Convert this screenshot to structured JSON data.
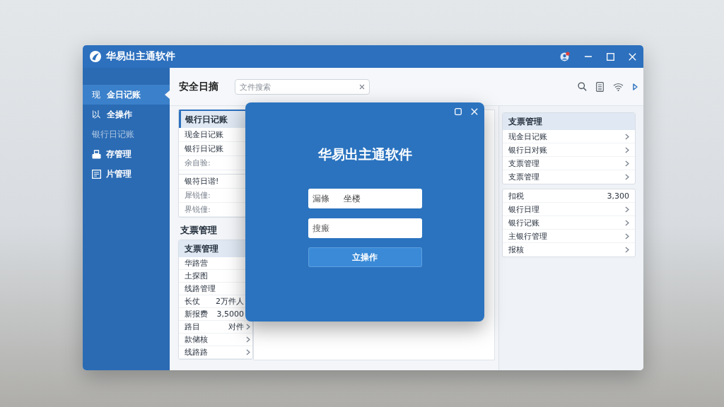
{
  "window": {
    "title": "华易出主通软件"
  },
  "sidebar": {
    "items": [
      {
        "kind": "glyph",
        "glyph": "现",
        "label": "金日记账",
        "selected": true,
        "disabled": false
      },
      {
        "kind": "glyph",
        "glyph": "以",
        "label": "全操作",
        "selected": false,
        "disabled": false
      },
      {
        "kind": "plain",
        "label": "银行日记账",
        "selected": false,
        "disabled": true
      },
      {
        "kind": "tray",
        "label": "存管理",
        "selected": false,
        "disabled": false
      },
      {
        "kind": "form",
        "label": "片管理",
        "selected": false,
        "disabled": false
      }
    ]
  },
  "header": {
    "title": "安全日摘",
    "search": {
      "placeholder": "文件搜索"
    }
  },
  "ledger_card": {
    "header": "银行日记账",
    "sections": [
      {
        "rows": [
          {
            "label": "现金日记账",
            "muted": false
          },
          {
            "label": "银行日记账",
            "muted": false
          },
          {
            "label": "余自验:",
            "muted": true
          }
        ]
      },
      {
        "rows": [
          {
            "label": "银符日谐!",
            "muted": false
          },
          {
            "label": "犀锐僮:",
            "muted": true
          },
          {
            "label": "界锐僮:",
            "muted": true
          }
        ]
      }
    ]
  },
  "check_section": {
    "title": "支票管理",
    "header": "支票管理",
    "rows": [
      {
        "label": "华路营"
      },
      {
        "label": "土探图"
      },
      {
        "label": "线路管理"
      },
      {
        "label": "长仗",
        "value": "2万件人"
      },
      {
        "label": "新报费",
        "value": "3,5000"
      },
      {
        "label": "路目",
        "value": "对件",
        "chevron": true
      },
      {
        "label": "款储核",
        "chevron": true
      },
      {
        "label": "线路路",
        "chevron": true
      }
    ]
  },
  "right_panel": {
    "cards": [
      {
        "header": "支票管理",
        "rows": [
          {
            "label": "现金日记账",
            "chevron": true
          },
          {
            "label": "银行日对账",
            "chevron": true
          },
          {
            "label": "支票管理",
            "chevron": true
          },
          {
            "label": "支票管理",
            "chevron": true
          }
        ]
      },
      {
        "rows": [
          {
            "label": "扣税",
            "value": "3,300",
            "chevron": false
          },
          {
            "label": "银行日理",
            "chevron": true
          },
          {
            "label": "银行记账",
            "chevron": true
          },
          {
            "label": "主银行管理",
            "chevron": true
          },
          {
            "label": "报核",
            "chevron": true
          }
        ]
      }
    ]
  },
  "dialog": {
    "title": "华易出主通软件",
    "fields": [
      {
        "label": "漏條",
        "value": "坐楼"
      },
      {
        "placeholder": "搜瘢"
      }
    ],
    "button": "立操作"
  }
}
